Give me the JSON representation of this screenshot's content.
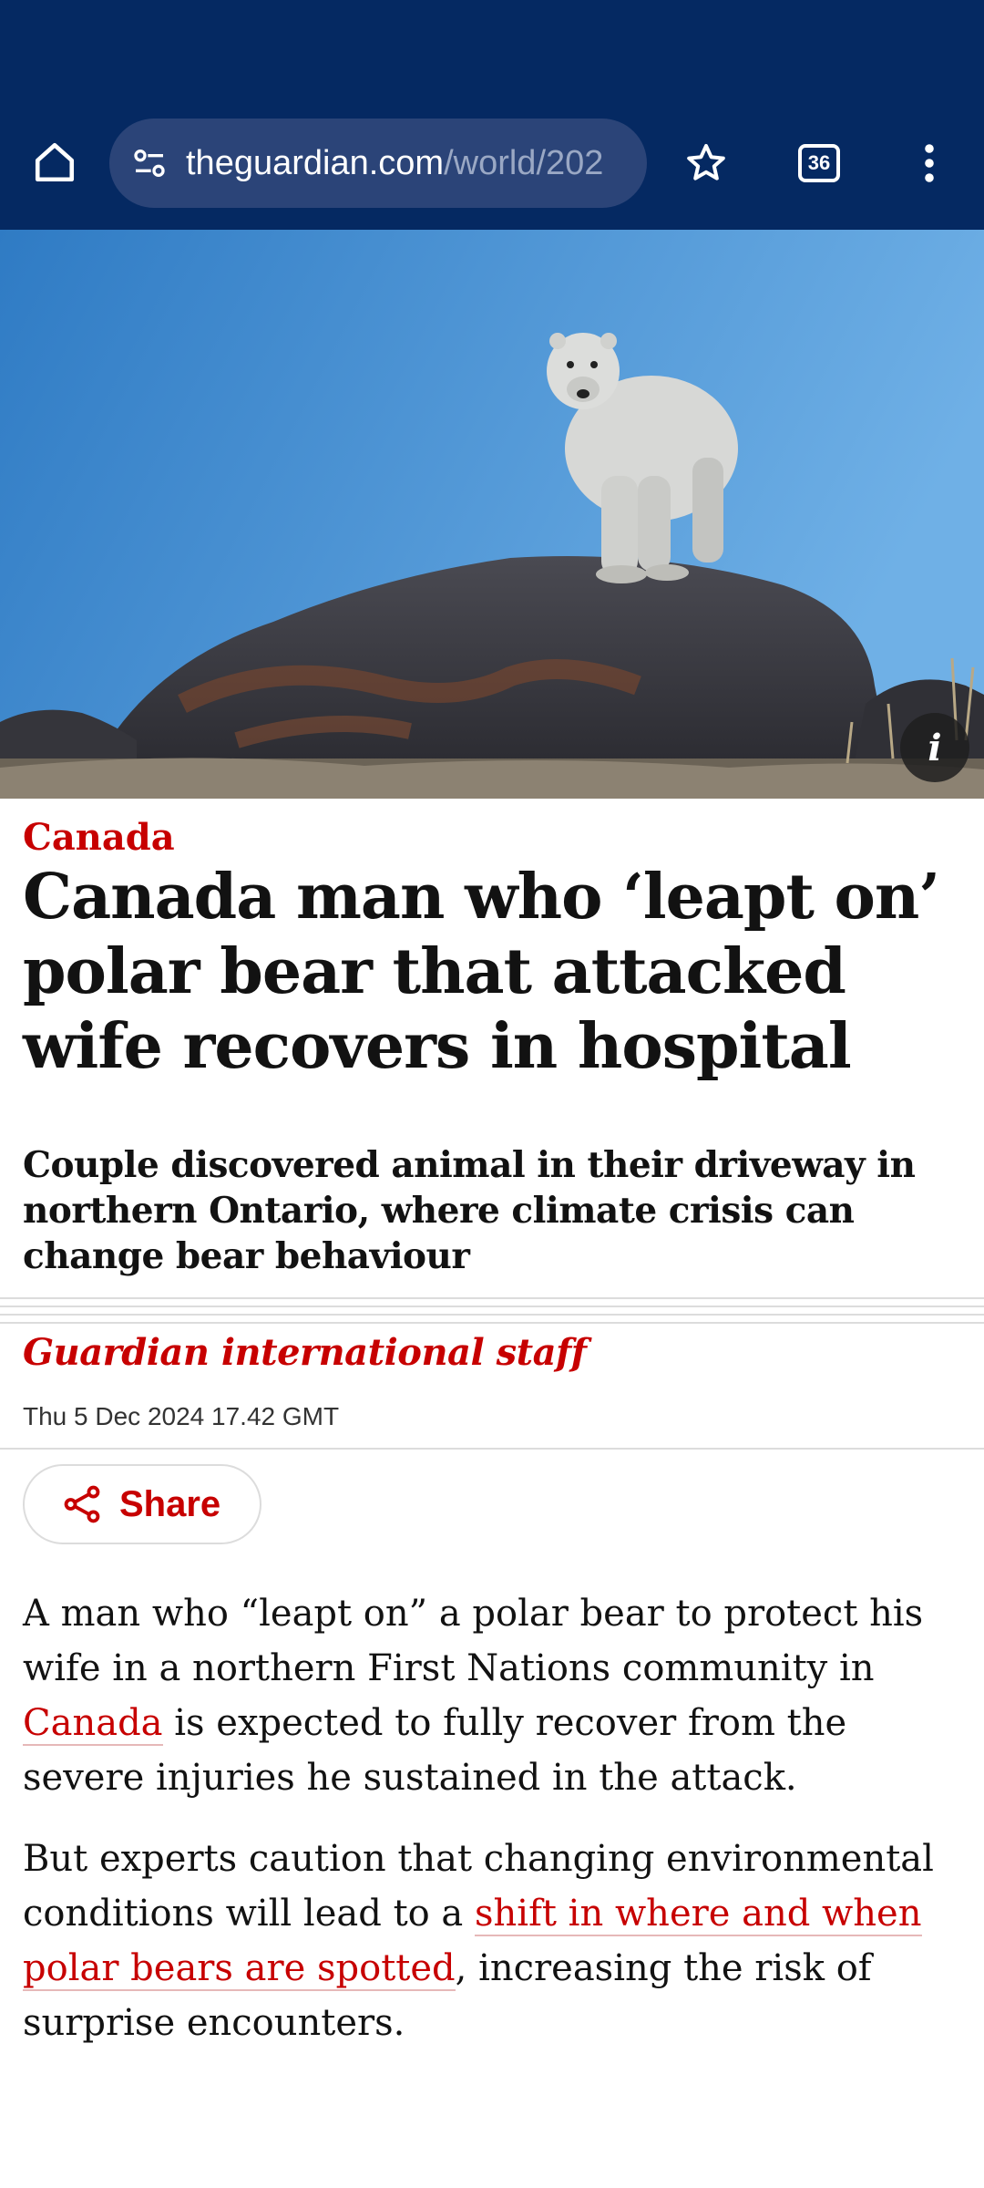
{
  "browser": {
    "url_host": "theguardian.com",
    "url_path": "/world/202",
    "tab_count": "36",
    "icons": [
      "home-icon",
      "site-settings-icon",
      "bookmark-star-icon",
      "tab-switcher-icon",
      "more-menu-icon"
    ]
  },
  "hero": {
    "info_label": "i"
  },
  "article": {
    "section": "Canada",
    "headline": "Canada man who ‘leapt on’ polar bear that attacked wife recovers in hospital",
    "standfirst": "Couple discovered animal in their driveway in northern Ontario, where climate crisis can change bear behaviour",
    "byline": "Guardian international staff",
    "date": "Thu 5 Dec 2024 17.42 GMT",
    "share_label": "Share",
    "para1": {
      "before": "A man who “leapt on” a polar bear to protect his wife in a northern First Nations community in ",
      "link": "Canada",
      "after": " is expected to fully recover from the severe injuries he sustained in the attack."
    },
    "para2": {
      "before": "But experts caution that changing environmental conditions will lead to a ",
      "link": "shift in where and when polar bears are spotted",
      "after": ", increasing the risk of surprise encounters."
    }
  },
  "colors": {
    "brand_navy": "#052962",
    "accent_red": "#c70000",
    "urlbar": "#2b4478"
  }
}
